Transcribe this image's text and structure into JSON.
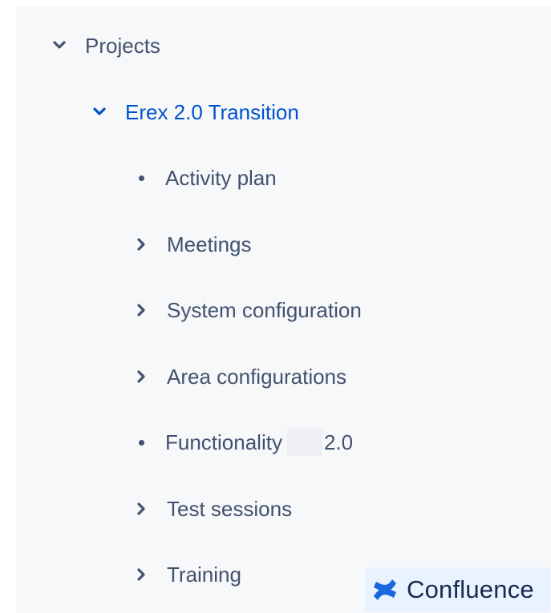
{
  "tree": {
    "parent": {
      "label": "Projects",
      "expanded": true
    },
    "current": {
      "label": "Erex 2.0 Transition",
      "expanded": true
    },
    "children": [
      {
        "label": "Activity plan",
        "marker": "bullet"
      },
      {
        "label": "Meetings",
        "marker": "chevron-right"
      },
      {
        "label": "System configuration",
        "marker": "chevron-right"
      },
      {
        "label": "Area configurations",
        "marker": "chevron-right"
      },
      {
        "label_before": "Functionality",
        "label_after": "2.0",
        "marker": "bullet",
        "redacted": true
      },
      {
        "label": "Test sessions",
        "marker": "chevron-right"
      },
      {
        "label": "Training",
        "marker": "chevron-right"
      }
    ]
  },
  "badge": {
    "label": "Confluence",
    "icon": "confluence-logo-icon"
  },
  "colors": {
    "panel_bg": "#f7f8fa",
    "text": "#42526e",
    "link": "#0052cc",
    "badge_bg": "#e9f2ff",
    "brand": "#1868db"
  }
}
